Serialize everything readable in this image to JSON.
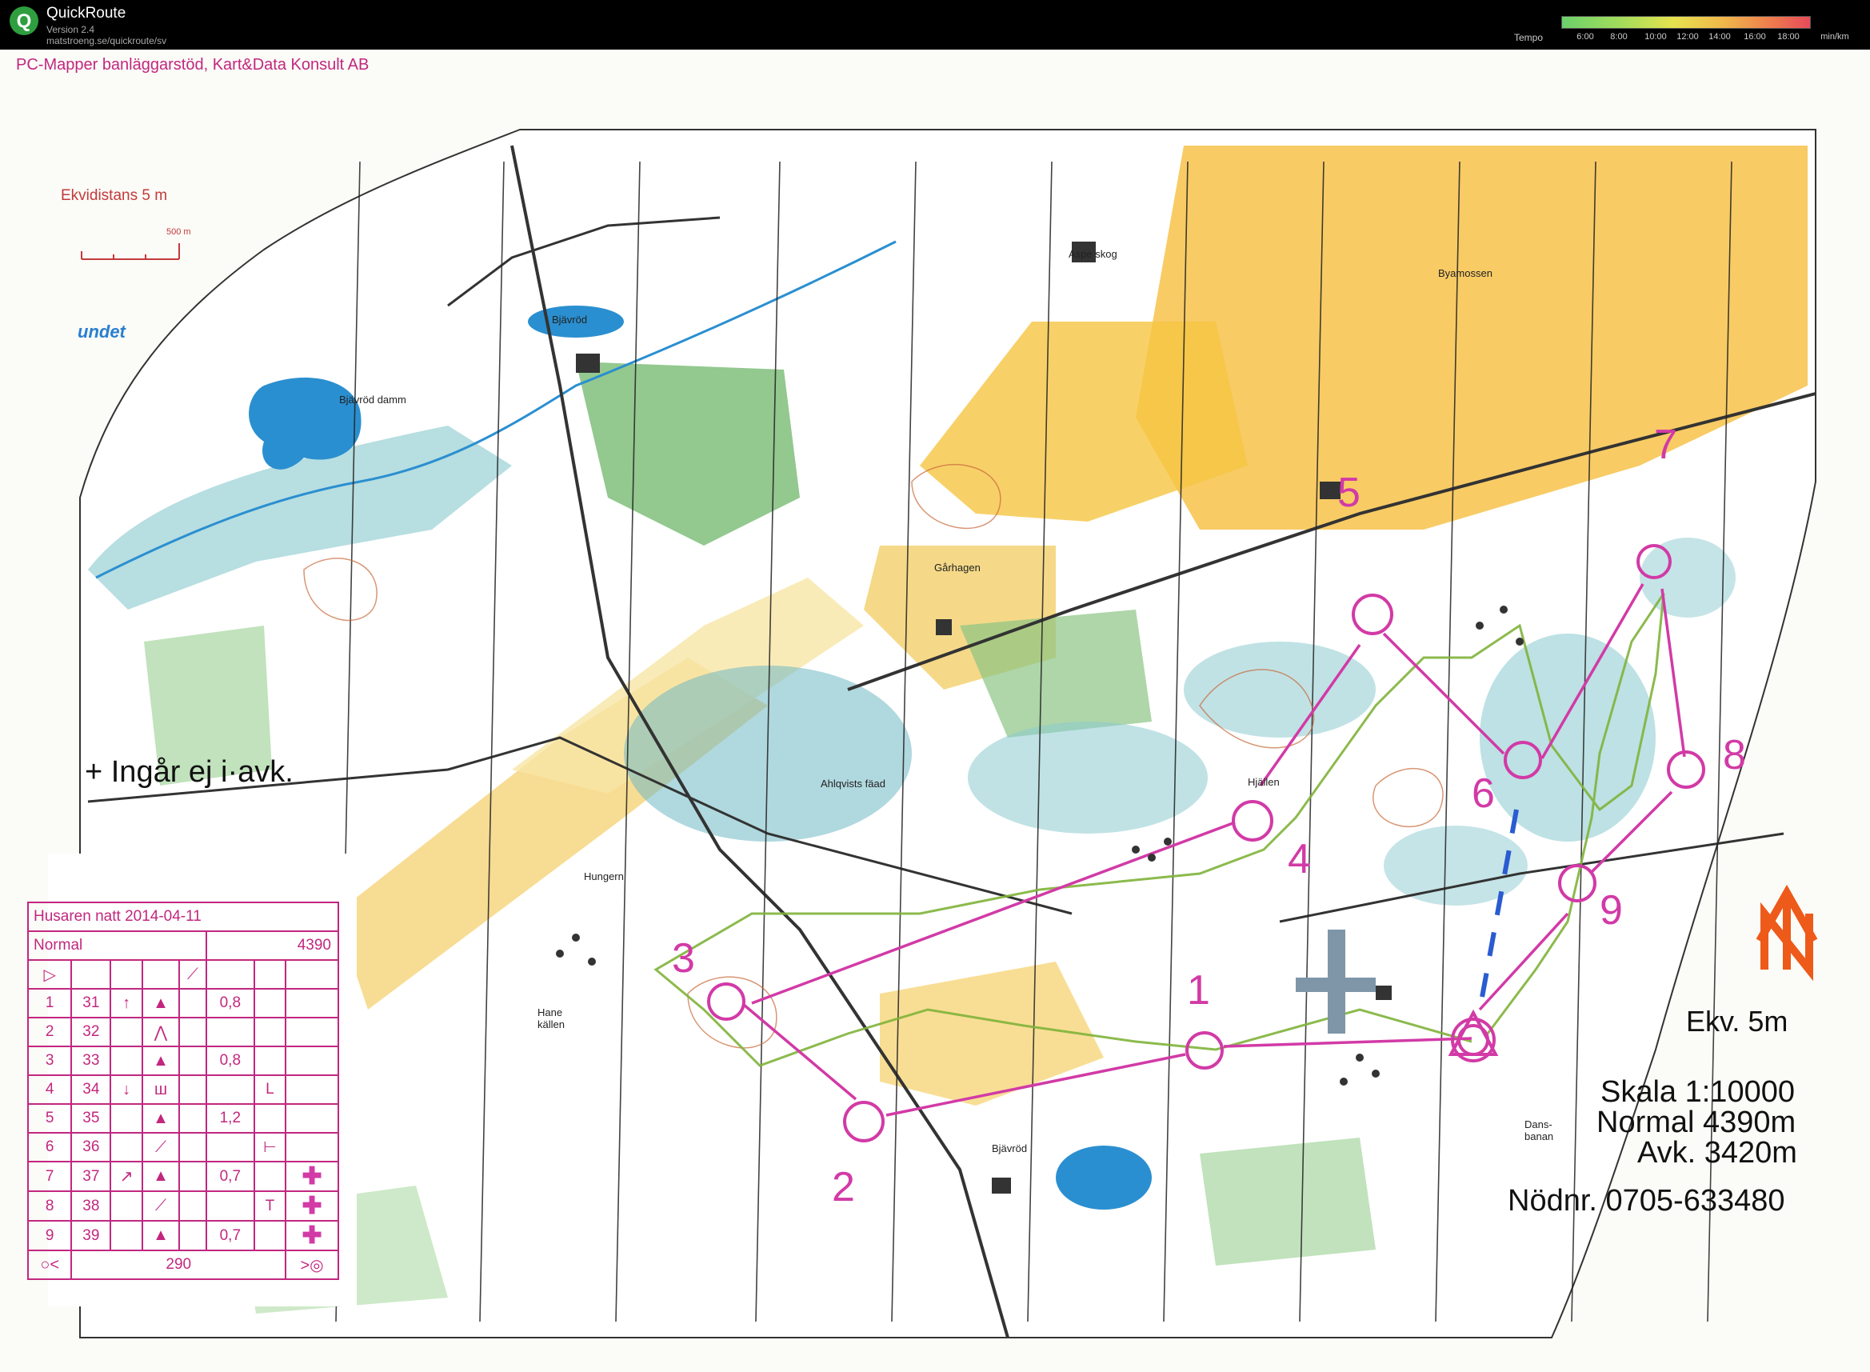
{
  "app": {
    "name": "QuickRoute",
    "version": "Version 2.4",
    "url": "matstroeng.se/quickroute/sv"
  },
  "tempo_legend": {
    "label": "Tempo",
    "ticks": [
      "6:00",
      "8:00",
      "10:00",
      "12:00",
      "14:00",
      "16:00",
      "18:00"
    ],
    "unit": "min/km",
    "colors": [
      "#6bd16b",
      "#a7dd5a",
      "#e6e24e",
      "#f0b84a",
      "#ee7a4e",
      "#e84a5a"
    ]
  },
  "map": {
    "header_credit": "PC-Mapper banläggarstöd, Kart&Data Konsult AB",
    "ekvidistans": "Ekvidistans 5 m",
    "scale_bar_label": "500 m",
    "area_fragment": "undet",
    "not_included_note": "+ Ingår ej i·avk.",
    "place_names": {
      "bjavrod_dam": "Bjävröd damm",
      "bjavrod": "Bjävröd",
      "aspe_skog": "Aspe skog",
      "byamossen": "Byamossen",
      "garhagen": "Gårhagen",
      "hjallen": "Hjällen",
      "hungern": "Hungern",
      "hane_kallen": "Hane källen",
      "bjavrod_south": "Bjävröd",
      "dansbanan": "Dans- banan",
      "ahlqvists": "Ahlqvists fäad"
    },
    "controls": [
      "1",
      "2",
      "3",
      "4",
      "5",
      "6",
      "7",
      "8",
      "9"
    ],
    "ekv": "Ekv. 5m",
    "skala": "Skala 1:10000",
    "normal_length": "Normal 4390m",
    "avk_length": "Avk. 3420m",
    "emergency": "Nödnr. 0705-633480",
    "colors": {
      "course": "#d23aa6",
      "route": "#7fb23a",
      "open_land": "#f5c542",
      "field": "#f0a030",
      "forest_green": "#6fb56a",
      "marsh": "#5fb0c0",
      "water": "#2a8fd0"
    }
  },
  "description_sheet": {
    "title": "Husaren natt 2014-04-11",
    "class_name": "Normal",
    "class_length": "4390",
    "rows": [
      {
        "num": "1",
        "code": "31",
        "dir": "↑",
        "feature": "▲",
        "detail": "",
        "dim": "0,8",
        "extra": "",
        "cross": false
      },
      {
        "num": "2",
        "code": "32",
        "dir": "",
        "feature": "⋀",
        "detail": "",
        "dim": "",
        "extra": "",
        "cross": false
      },
      {
        "num": "3",
        "code": "33",
        "dir": "",
        "feature": "▲",
        "detail": "",
        "dim": "0,8",
        "extra": "",
        "cross": false
      },
      {
        "num": "4",
        "code": "34",
        "dir": "↓",
        "feature": "ш",
        "detail": "",
        "dim": "",
        "extra": "L",
        "cross": false
      },
      {
        "num": "5",
        "code": "35",
        "dir": "",
        "feature": "▲",
        "detail": "",
        "dim": "1,2",
        "extra": "",
        "cross": false
      },
      {
        "num": "6",
        "code": "36",
        "dir": "",
        "feature": "⟋",
        "detail": "",
        "dim": "",
        "extra": "⊢",
        "cross": false
      },
      {
        "num": "7",
        "code": "37",
        "dir": "↗",
        "feature": "▲",
        "detail": "",
        "dim": "0,7",
        "extra": "",
        "cross": true
      },
      {
        "num": "8",
        "code": "38",
        "dir": "",
        "feature": "⟋",
        "detail": "",
        "dim": "",
        "extra": "T",
        "cross": true
      },
      {
        "num": "9",
        "code": "39",
        "dir": "",
        "feature": "▲",
        "detail": "",
        "dim": "0,7",
        "extra": "",
        "cross": true
      }
    ],
    "finish_distance": "290"
  }
}
